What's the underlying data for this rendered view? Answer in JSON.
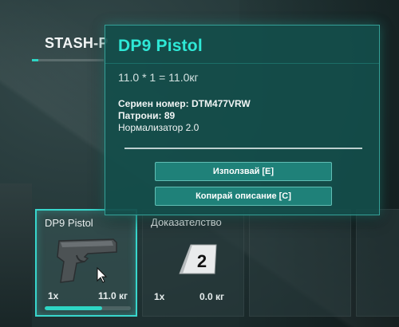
{
  "stash": {
    "title": "STASH-P"
  },
  "tooltip": {
    "item_name": "DP9 Pistol",
    "weight_formula": "11.0 * 1 = 11.0кг",
    "serial_label": "Сериен номер:",
    "serial_value": "DTM477VRW",
    "ammo_label": "Патрони:",
    "ammo_value": "89",
    "attachment": "Нормализатор 2.0",
    "use_button": "Използвай [E]",
    "copy_button": "Копирай описание [C]"
  },
  "slots": [
    {
      "name": "DP9 Pistol",
      "quantity": "1x",
      "weight": "11.0 кг",
      "durability": 0.67,
      "icon": "pistol-icon"
    },
    {
      "name": "Доказателство",
      "quantity": "1x",
      "weight": "0.0 кг",
      "icon": "evidence-marker-icon",
      "marker_number": "2"
    }
  ],
  "colors": {
    "accent": "#2ed5c4",
    "title": "#2ee8d6",
    "panel": "#134e4a"
  }
}
